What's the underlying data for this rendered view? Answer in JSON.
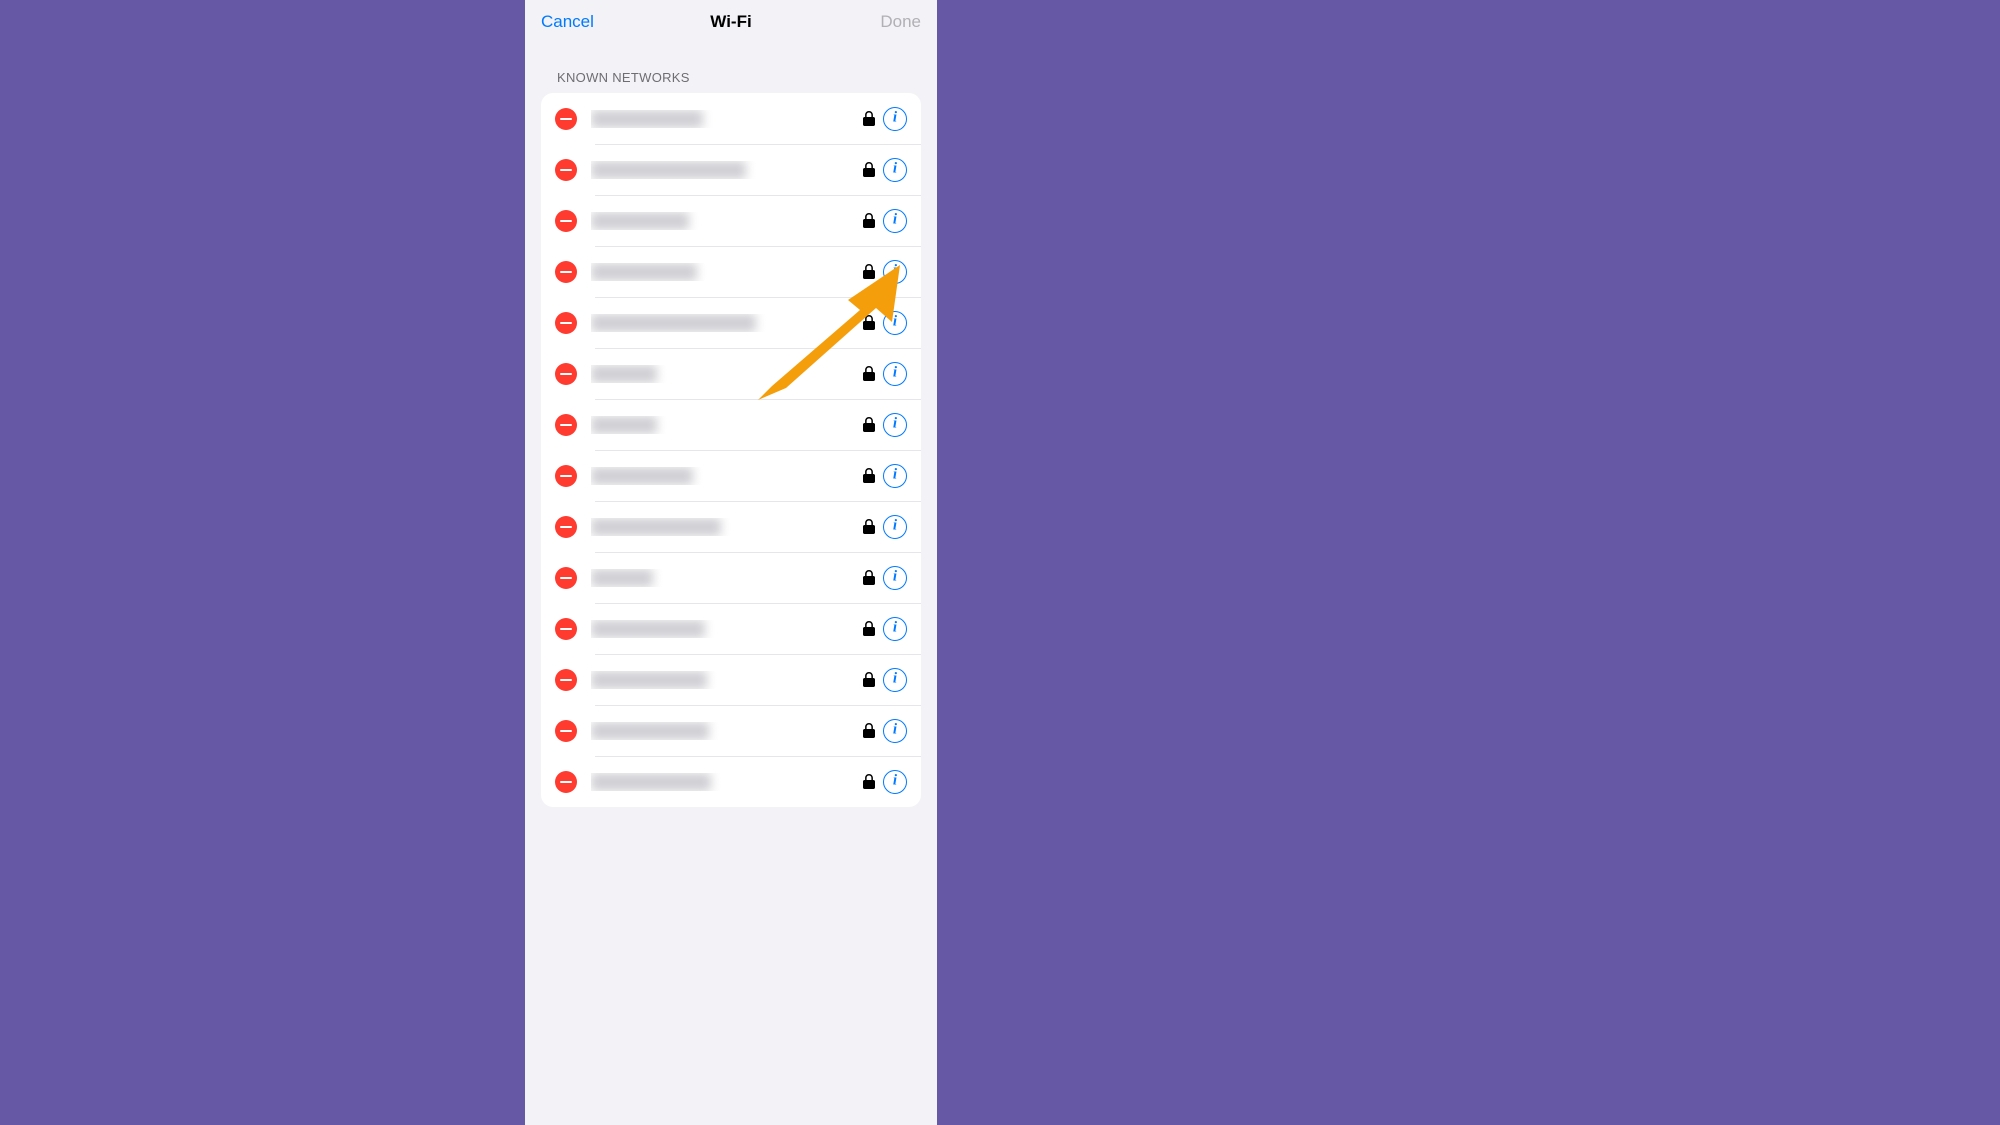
{
  "nav": {
    "cancel": "Cancel",
    "title": "Wi-Fi",
    "done": "Done"
  },
  "section": {
    "header": "KNOWN NETWORKS"
  },
  "networks": [
    {
      "name": "████████████",
      "secured": true,
      "blurWidth": 112
    },
    {
      "name": "████████████████",
      "secured": true,
      "blurWidth": 155
    },
    {
      "name": "██████████",
      "secured": true,
      "blurWidth": 98
    },
    {
      "name": "███████████",
      "secured": true,
      "blurWidth": 106
    },
    {
      "name": "█████████████████",
      "secured": true,
      "blurWidth": 165
    },
    {
      "name": "███████",
      "secured": true,
      "blurWidth": 66
    },
    {
      "name": "███████",
      "secured": true,
      "blurWidth": 66
    },
    {
      "name": "██████████",
      "secured": true,
      "blurWidth": 102
    },
    {
      "name": "█████████████",
      "secured": true,
      "blurWidth": 130
    },
    {
      "name": "██████",
      "secured": true,
      "blurWidth": 62
    },
    {
      "name": "████████████",
      "secured": true,
      "blurWidth": 114
    },
    {
      "name": "████████████",
      "secured": true,
      "blurWidth": 116
    },
    {
      "name": "████████████",
      "secured": true,
      "blurWidth": 118
    },
    {
      "name": "████████████",
      "secured": true,
      "blurWidth": 120
    }
  ],
  "icons": {
    "delete": "minus-circle-icon",
    "lock": "lock-icon",
    "info": "info-icon"
  },
  "annotation": {
    "arrow_color": "#f59e0b"
  }
}
